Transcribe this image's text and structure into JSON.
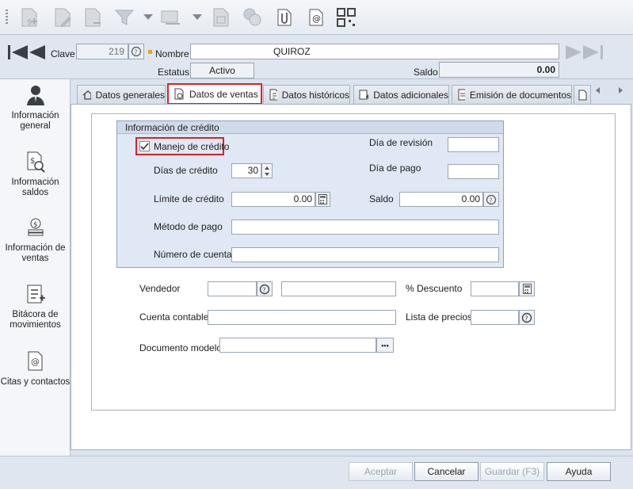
{
  "header": {
    "clave_label": "Clave",
    "clave_value": "219",
    "nombre_label": "Nombre",
    "nombre_value": "QUIROZ",
    "estatus_label": "Estatus",
    "estatus_value": "Activo",
    "saldo_label": "Saldo",
    "saldo_value": "0.00"
  },
  "sidebar": {
    "items": [
      {
        "label": "Información general"
      },
      {
        "label": "Información saldos"
      },
      {
        "label": "Información de ventas"
      },
      {
        "label": "Bitácora de movimientos"
      },
      {
        "label": "Citas y contactos"
      }
    ]
  },
  "tabs": [
    {
      "label": "Datos generales"
    },
    {
      "label": "Datos de ventas"
    },
    {
      "label": "Datos históricos"
    },
    {
      "label": "Datos adicionales"
    },
    {
      "label": "Emisión de documentos"
    }
  ],
  "credit": {
    "title": "Información de crédito",
    "manejo_label": "Manejo de crédito",
    "dias_label": "Días de crédito",
    "dias_value": "30",
    "limite_label": "Límite de crédito",
    "limite_value": "0.00",
    "metodo_label": "Método de pago",
    "metodo_value": "",
    "cuenta_label": "Número de cuenta",
    "cuenta_value": "",
    "revision_label": "Día de revisión",
    "revision_value": "",
    "pago_label": "Día de pago",
    "pago_value": "",
    "saldo_label": "Saldo",
    "saldo_value": "0.00"
  },
  "ventas": {
    "vendedor_label": "Vendedor",
    "descuento_label": "% Descuento",
    "cuenta_contable_label": "Cuenta contable",
    "lista_precios_label": "Lista de precios",
    "documento_modelo_label": "Documento modelo",
    "browse_glyph": "•••"
  },
  "footer": {
    "aceptar": "Aceptar",
    "cancelar": "Cancelar",
    "guardar": "Guardar (F3)",
    "ayuda": "Ayuda"
  }
}
